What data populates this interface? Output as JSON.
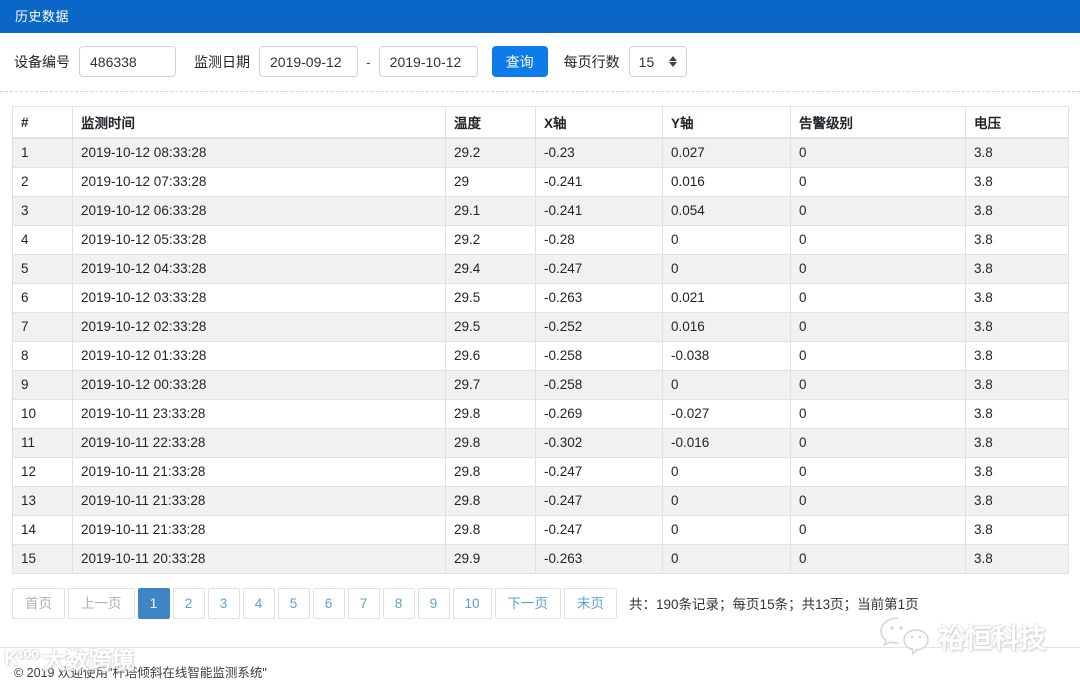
{
  "colors": {
    "titlebar": "#0a67c7",
    "primary": "#0d7ce8",
    "pagelink": "#5e9fd4",
    "pageactive": "#3d85c4"
  },
  "header": {
    "title": "历史数据"
  },
  "filters": {
    "device_label": "设备编号",
    "device_value": "486338",
    "date_label": "监测日期",
    "date_from": "2019-09-12",
    "date_separator": "-",
    "date_to": "2019-10-12",
    "query_button": "查询",
    "rows_label": "每页行数",
    "rows_value": "15"
  },
  "table": {
    "columns": [
      "#",
      "监测时间",
      "温度",
      "X轴",
      "Y轴",
      "告警级别",
      "电压"
    ],
    "rows": [
      [
        "1",
        "2019-10-12 08:33:28",
        "29.2",
        "-0.23",
        "0.027",
        "0",
        "3.8"
      ],
      [
        "2",
        "2019-10-12 07:33:28",
        "29",
        "-0.241",
        "0.016",
        "0",
        "3.8"
      ],
      [
        "3",
        "2019-10-12 06:33:28",
        "29.1",
        "-0.241",
        "0.054",
        "0",
        "3.8"
      ],
      [
        "4",
        "2019-10-12 05:33:28",
        "29.2",
        "-0.28",
        "0",
        "0",
        "3.8"
      ],
      [
        "5",
        "2019-10-12 04:33:28",
        "29.4",
        "-0.247",
        "0",
        "0",
        "3.8"
      ],
      [
        "6",
        "2019-10-12 03:33:28",
        "29.5",
        "-0.263",
        "0.021",
        "0",
        "3.8"
      ],
      [
        "7",
        "2019-10-12 02:33:28",
        "29.5",
        "-0.252",
        "0.016",
        "0",
        "3.8"
      ],
      [
        "8",
        "2019-10-12 01:33:28",
        "29.6",
        "-0.258",
        "-0.038",
        "0",
        "3.8"
      ],
      [
        "9",
        "2019-10-12 00:33:28",
        "29.7",
        "-0.258",
        "0",
        "0",
        "3.8"
      ],
      [
        "10",
        "2019-10-11 23:33:28",
        "29.8",
        "-0.269",
        "-0.027",
        "0",
        "3.8"
      ],
      [
        "11",
        "2019-10-11 22:33:28",
        "29.8",
        "-0.302",
        "-0.016",
        "0",
        "3.8"
      ],
      [
        "12",
        "2019-10-11 21:33:28",
        "29.8",
        "-0.247",
        "0",
        "0",
        "3.8"
      ],
      [
        "13",
        "2019-10-11 21:33:28",
        "29.8",
        "-0.247",
        "0",
        "0",
        "3.8"
      ],
      [
        "14",
        "2019-10-11 21:33:28",
        "29.8",
        "-0.247",
        "0",
        "0",
        "3.8"
      ],
      [
        "15",
        "2019-10-11 20:33:28",
        "29.9",
        "-0.263",
        "0",
        "0",
        "3.8"
      ]
    ]
  },
  "pagination": {
    "first": "首页",
    "prev": "上一页",
    "pages": [
      "1",
      "2",
      "3",
      "4",
      "5",
      "6",
      "7",
      "8",
      "9",
      "10"
    ],
    "active_page": "1",
    "next": "下一页",
    "last": "末页",
    "summary": "共：190条记录；每页15条；共13页；当前第1页"
  },
  "footer": {
    "copyright": "© 2019 欢迎使用\"杆塔倾斜在线智能监测系统\""
  },
  "watermarks": {
    "left_text": "大数跨境",
    "right_text": "裕恒科技"
  }
}
